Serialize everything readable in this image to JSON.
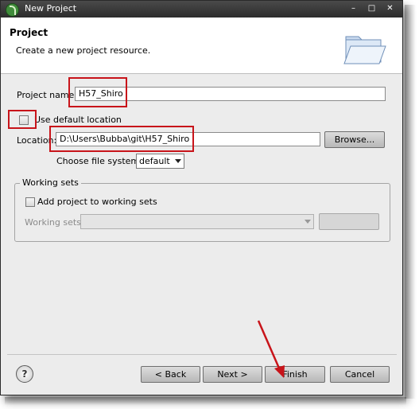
{
  "window": {
    "title": "New Project",
    "controls": {
      "minimize": "–",
      "maximize": "□",
      "close": "✕"
    }
  },
  "header": {
    "title": "Project",
    "description": "Create a new project resource.",
    "icon": "open-folder-icon"
  },
  "form": {
    "project_name_label": "Project name:",
    "project_name_value": "H57_Shiro",
    "use_default_label": "Use default location",
    "use_default_checked": false,
    "location_label": "Location:",
    "location_value": "D:\\Users\\Bubba\\git\\H57_Shiro",
    "browse_label": "Browse...",
    "file_system_label": "Choose file system:",
    "file_system_value": "default"
  },
  "working_sets": {
    "legend": "Working sets",
    "add_label": "Add project to working sets",
    "add_checked": false,
    "sets_label": "Working sets:",
    "sets_value": "",
    "select_label": ""
  },
  "footer": {
    "back_label": "< Back",
    "next_label": "Next >",
    "finish_label": "Finish",
    "cancel_label": "Cancel",
    "help_glyph": "?"
  },
  "colors": {
    "annotation": "#c8141a",
    "title_bar": "#2c2c2c",
    "dialog_bg": "#ececec"
  }
}
